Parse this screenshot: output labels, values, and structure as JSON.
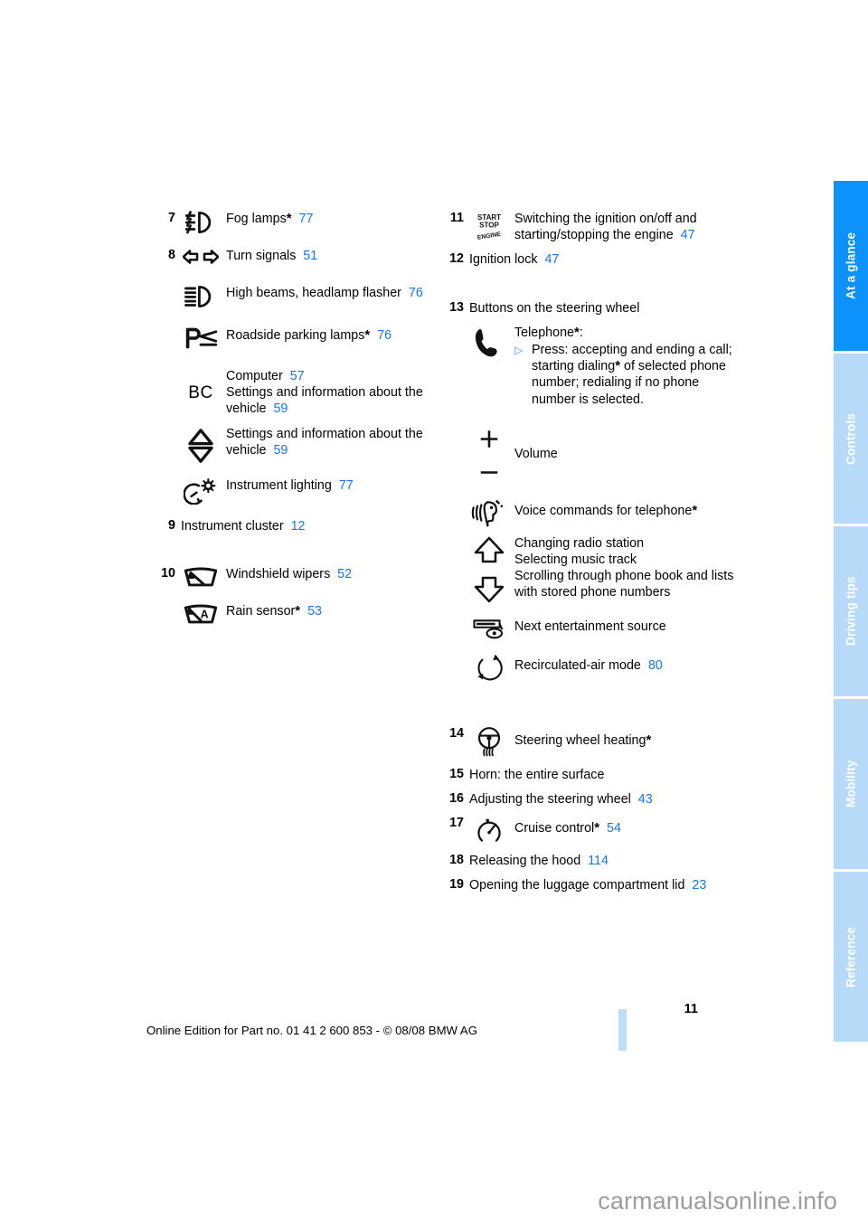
{
  "document": {
    "page_number": "11",
    "footer_note": "Online Edition for Part no. 01 41 2 600 853 - © 08/08 BMW AG",
    "watermark": "carmanualsonline.info"
  },
  "colors": {
    "accent_blue": "#1277ec",
    "tab_active": "#0d92fb",
    "tab_inactive": "#b8daf9",
    "page_ref": "#1277ec"
  },
  "rail": {
    "tabs": [
      {
        "label": "At a glance",
        "active": true
      },
      {
        "label": "Controls",
        "active": false
      },
      {
        "label": "Driving tips",
        "active": false
      },
      {
        "label": "Mobility",
        "active": false
      },
      {
        "label": "Reference",
        "active": false
      }
    ]
  },
  "left_column": {
    "items": [
      {
        "num": "7",
        "icon": "fog-lamps-icon",
        "label": "Fog lamps",
        "star": "*",
        "page": "77"
      },
      {
        "num": "8",
        "icon": "turn-signals-icon",
        "label": "Turn signals",
        "star": "",
        "page": "51"
      },
      {
        "num": "",
        "icon": "high-beams-icon",
        "label": "High beams, headlamp flasher",
        "star": "",
        "page": "76"
      },
      {
        "num": "",
        "icon": "roadside-parking-lamps-icon",
        "label": "Roadside parking lamps",
        "star": "*",
        "page": "76"
      },
      {
        "num": "",
        "icon": "bc-computer-icon",
        "label": "Computer",
        "star": "",
        "page": "57",
        "sublabel": "Settings and information about the vehicle",
        "subpage": "59"
      },
      {
        "num": "",
        "icon": "up-down-triangle-icon",
        "label": "Settings and information about the vehicle",
        "star": "",
        "page": "59"
      },
      {
        "num": "",
        "icon": "instrument-lighting-icon",
        "label": "Instrument lighting",
        "star": "",
        "page": "77"
      },
      {
        "num": "9",
        "icon": "",
        "label": "Instrument cluster",
        "star": "",
        "page": "12"
      },
      {
        "num": "10",
        "icon": "windshield-wipers-icon",
        "label": "Windshield wipers",
        "star": "",
        "page": "52"
      },
      {
        "num": "",
        "icon": "rain-sensor-icon",
        "label": "Rain sensor",
        "star": "*",
        "page": "53"
      }
    ]
  },
  "right_column": {
    "item_11": {
      "num": "11",
      "icon": "start-stop-engine-icon",
      "label": "Switching the ignition on/off and starting/stopping the engine",
      "page": "47"
    },
    "item_12": {
      "num": "12",
      "label": "Ignition lock",
      "page": "47"
    },
    "item_13": {
      "num": "13",
      "heading": "Buttons on the steering wheel",
      "telephone": {
        "icon": "telephone-handset-icon",
        "label": "Telephone",
        "star": "*",
        "colon": ":",
        "bullet": "▷",
        "detail_a": "Press: accepting and ending a call; starting dialing",
        "detail_star": "*",
        "detail_b": " of selected phone number; redialing if no phone number is selected."
      },
      "volume": {
        "icon_plus": "plus-icon",
        "icon_minus": "minus-icon",
        "label": "Volume"
      },
      "voice": {
        "icon": "voice-command-icon",
        "label": "Voice commands for telephone",
        "star": "*"
      },
      "arrows": {
        "icon_up": "arrow-up-icon",
        "icon_down": "arrow-down-icon",
        "line1": "Changing radio station",
        "line2": "Selecting music track",
        "line3": "Scrolling through phone book and lists with stored phone numbers"
      },
      "entertainment": {
        "icon": "entertainment-source-icon",
        "label": "Next entertainment source"
      },
      "recirc": {
        "icon": "recirculated-air-icon",
        "label": "Recirculated-air mode",
        "page": "80"
      }
    },
    "item_14": {
      "num": "14",
      "icon": "steering-wheel-heating-icon",
      "label": "Steering wheel heating",
      "star": "*"
    },
    "item_15": {
      "num": "15",
      "label": "Horn: the entire surface"
    },
    "item_16": {
      "num": "16",
      "label": "Adjusting the steering wheel",
      "page": "43"
    },
    "item_17": {
      "num": "17",
      "icon": "cruise-control-icon",
      "label": "Cruise control",
      "star": "*",
      "page": "54"
    },
    "item_18": {
      "num": "18",
      "label": "Releasing the hood",
      "page": "114"
    },
    "item_19": {
      "num": "19",
      "label": "Opening the luggage compartment lid",
      "page": "23"
    }
  }
}
